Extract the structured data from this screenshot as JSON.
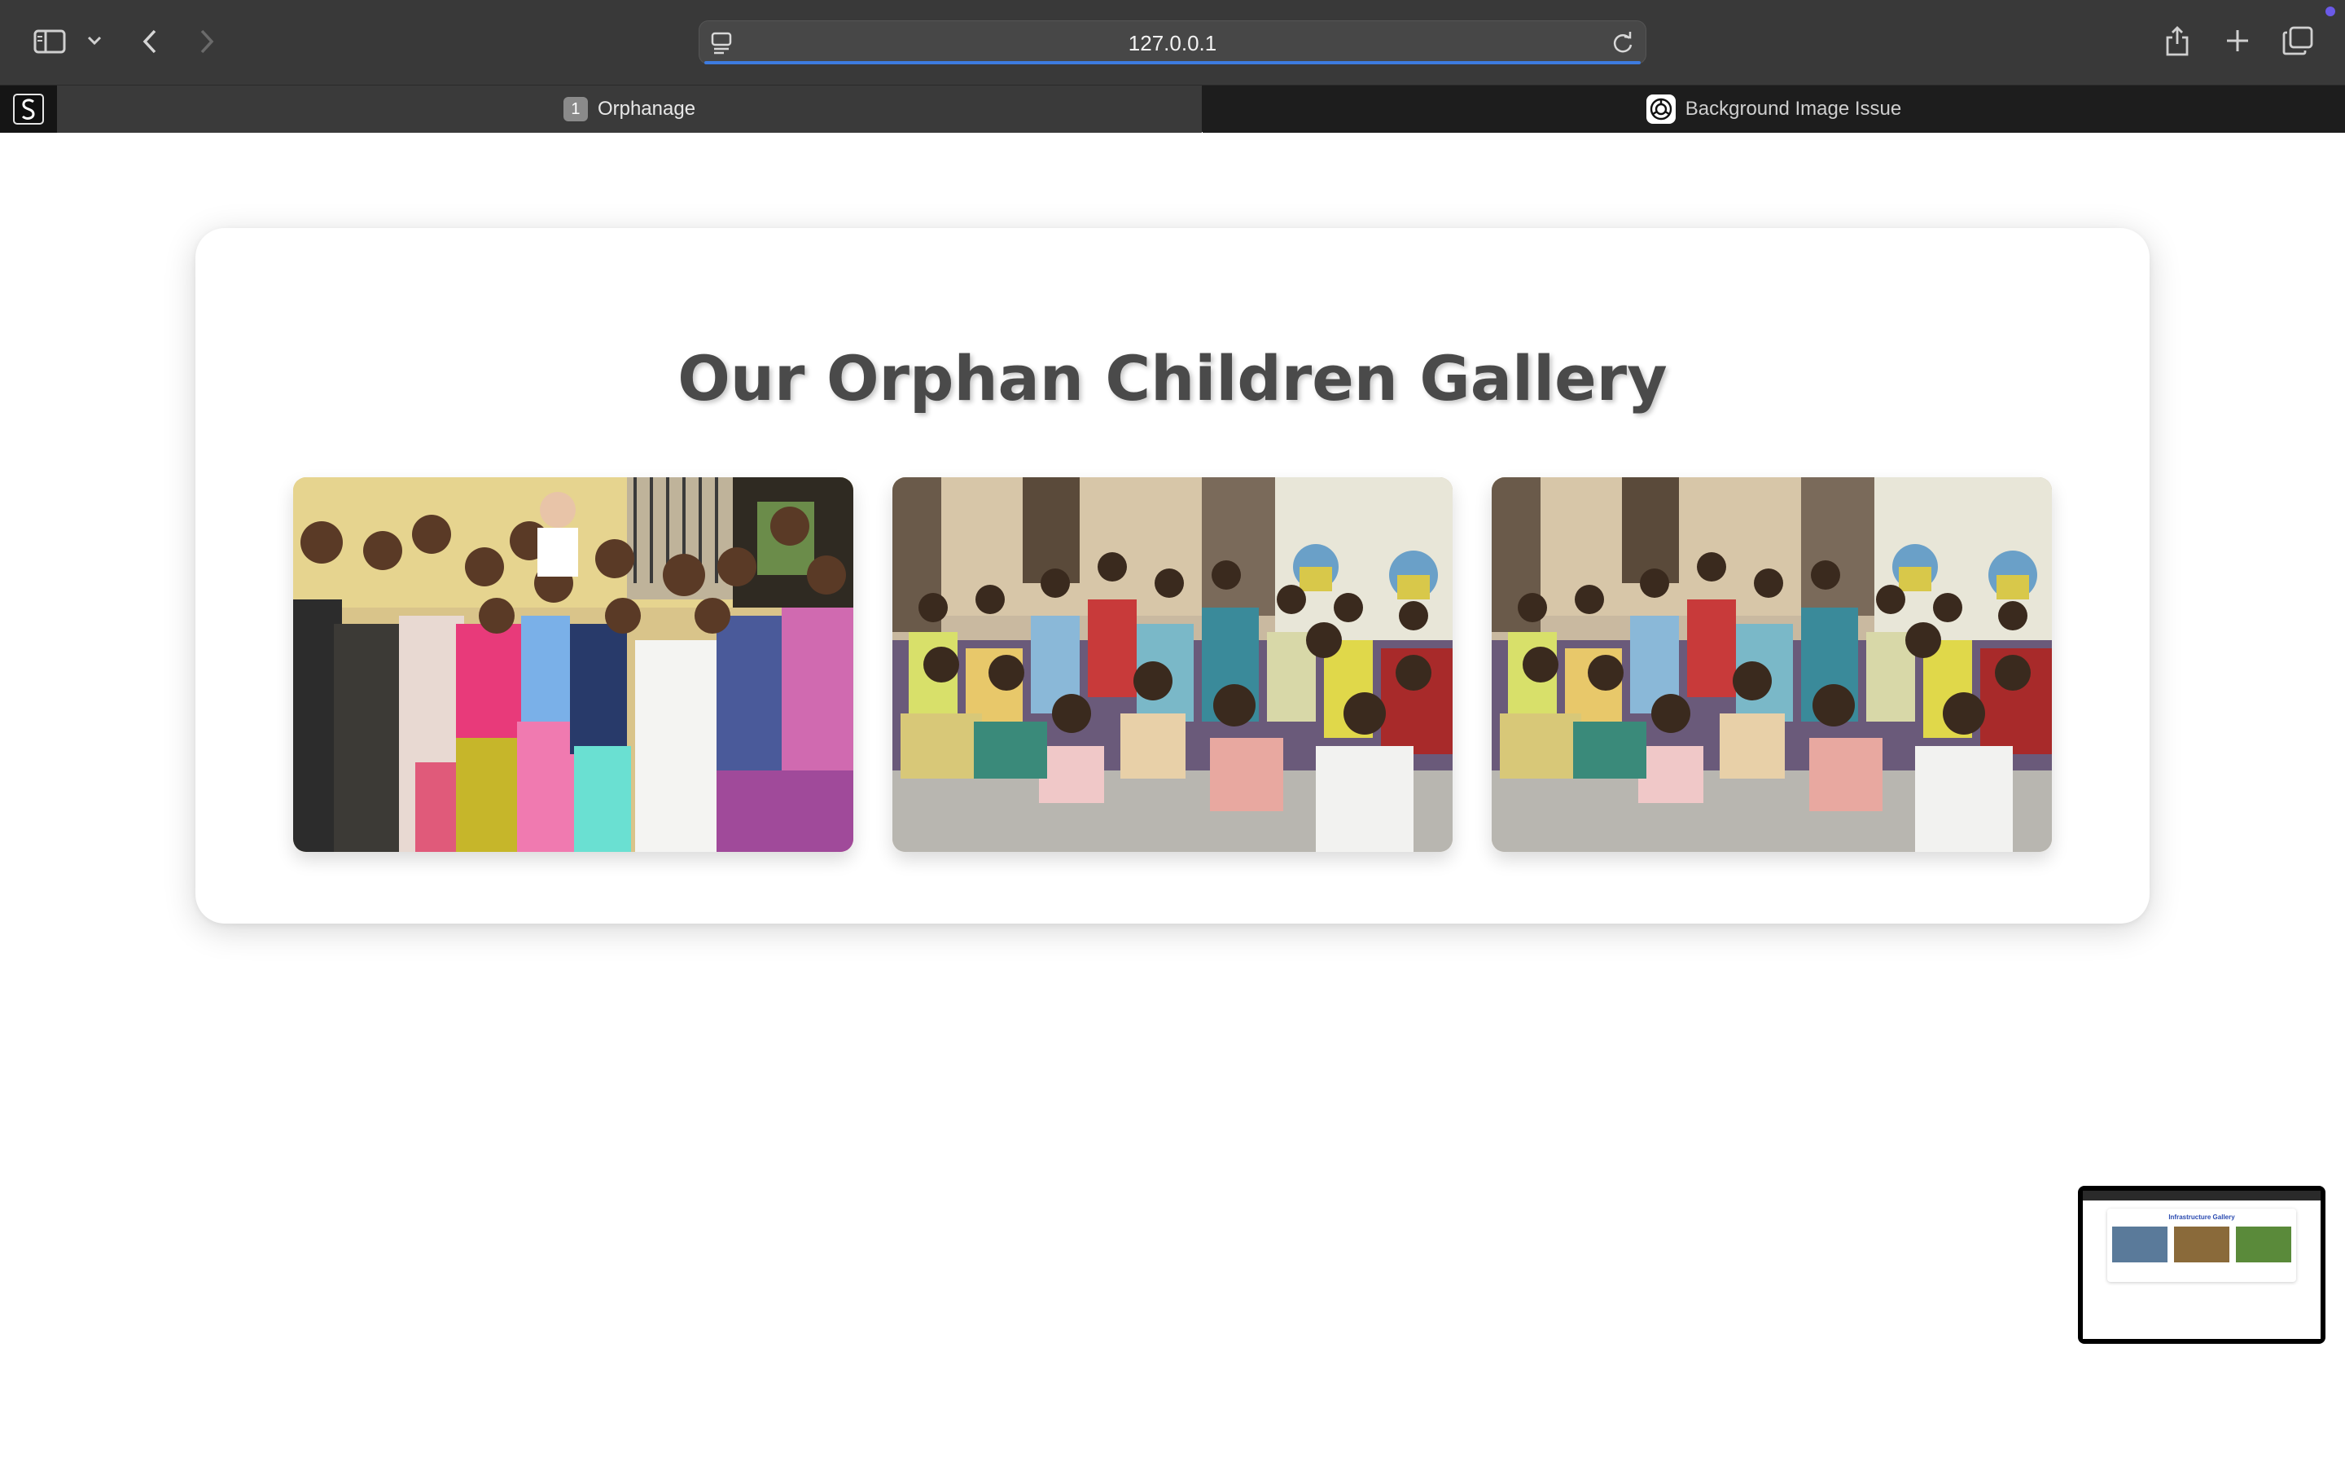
{
  "browser": {
    "url": "127.0.0.1",
    "tabs": [
      {
        "number": "1",
        "label": "Orphanage",
        "active": true
      },
      {
        "label": "Background Image Issue",
        "active": false,
        "favicon": "chatgpt-icon"
      }
    ],
    "icons": [
      "sidebar-icon",
      "chevron-down-icon",
      "back-icon",
      "forward-icon",
      "reader-icon",
      "reload-icon",
      "share-icon",
      "new-tab-icon",
      "tab-overview-icon"
    ]
  },
  "page": {
    "title": "Our Orphan Children Gallery",
    "photos": [
      {
        "subject": "group-of-girls-photo"
      },
      {
        "subject": "children-seated-photo"
      },
      {
        "subject": "children-seated-photo"
      }
    ]
  },
  "thumbnail": {
    "title": "Infrastructure Gallery"
  },
  "colors": {
    "chrome": "#393939",
    "tabbar": "#1d1d1d",
    "accent": "#3d7be0",
    "title": "#4a4a4a"
  }
}
